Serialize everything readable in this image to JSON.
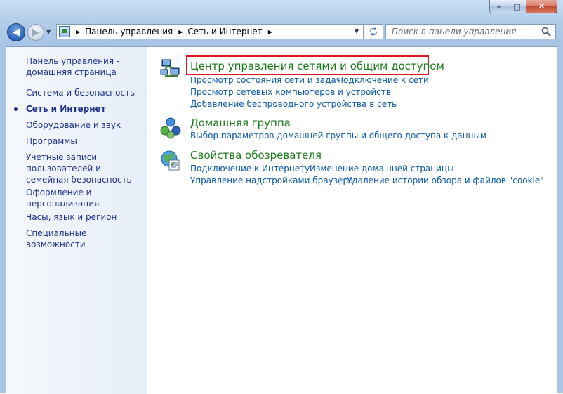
{
  "window": {
    "minimize_symbol": "–",
    "maximize_symbol": "□",
    "close_symbol": "✕"
  },
  "nav": {
    "back_symbol": "◀",
    "forward_symbol": "▶"
  },
  "address": {
    "crumbs": [
      "Панель управления",
      "Сеть и Интернет"
    ]
  },
  "search": {
    "placeholder": "Поиск в панели управления"
  },
  "sidebar": {
    "items": [
      {
        "label": "Панель управления - домашняя страница"
      },
      {
        "label": "Система и безопасность"
      },
      {
        "label": "Сеть и Интернет"
      },
      {
        "label": "Оборудование и звук"
      },
      {
        "label": "Программы"
      },
      {
        "label": "Учетные записи пользователей и семейная безопасность"
      },
      {
        "label": "Оформление и персонализация"
      },
      {
        "label": "Часы, язык и регион"
      },
      {
        "label": "Специальные возможности"
      }
    ]
  },
  "categories": [
    {
      "title": "Центр управления сетями и общим доступом",
      "icon": "network-center-icon",
      "links": [
        "Просмотр состояния сети и задач",
        "Подключение к сети",
        "Просмотр сетевых компьютеров и устройств",
        "Добавление беспроводного устройства в сеть"
      ]
    },
    {
      "title": "Домашняя группа",
      "icon": "homegroup-icon",
      "links": [
        "Выбор параметров домашней группы и общего доступа к данным"
      ]
    },
    {
      "title": "Свойства обозревателя",
      "icon": "internet-options-icon",
      "links": [
        "Подключение к Интернету",
        "Изменение домашней страницы",
        "Управление надстройками браузера",
        "Удаление истории обзора и файлов \"cookie\""
      ]
    }
  ],
  "colors": {
    "link": "#0b5aa8",
    "category_title": "#1a7a1a",
    "sidebar_text": "#1e3287",
    "highlight_box": "#e0141c"
  }
}
